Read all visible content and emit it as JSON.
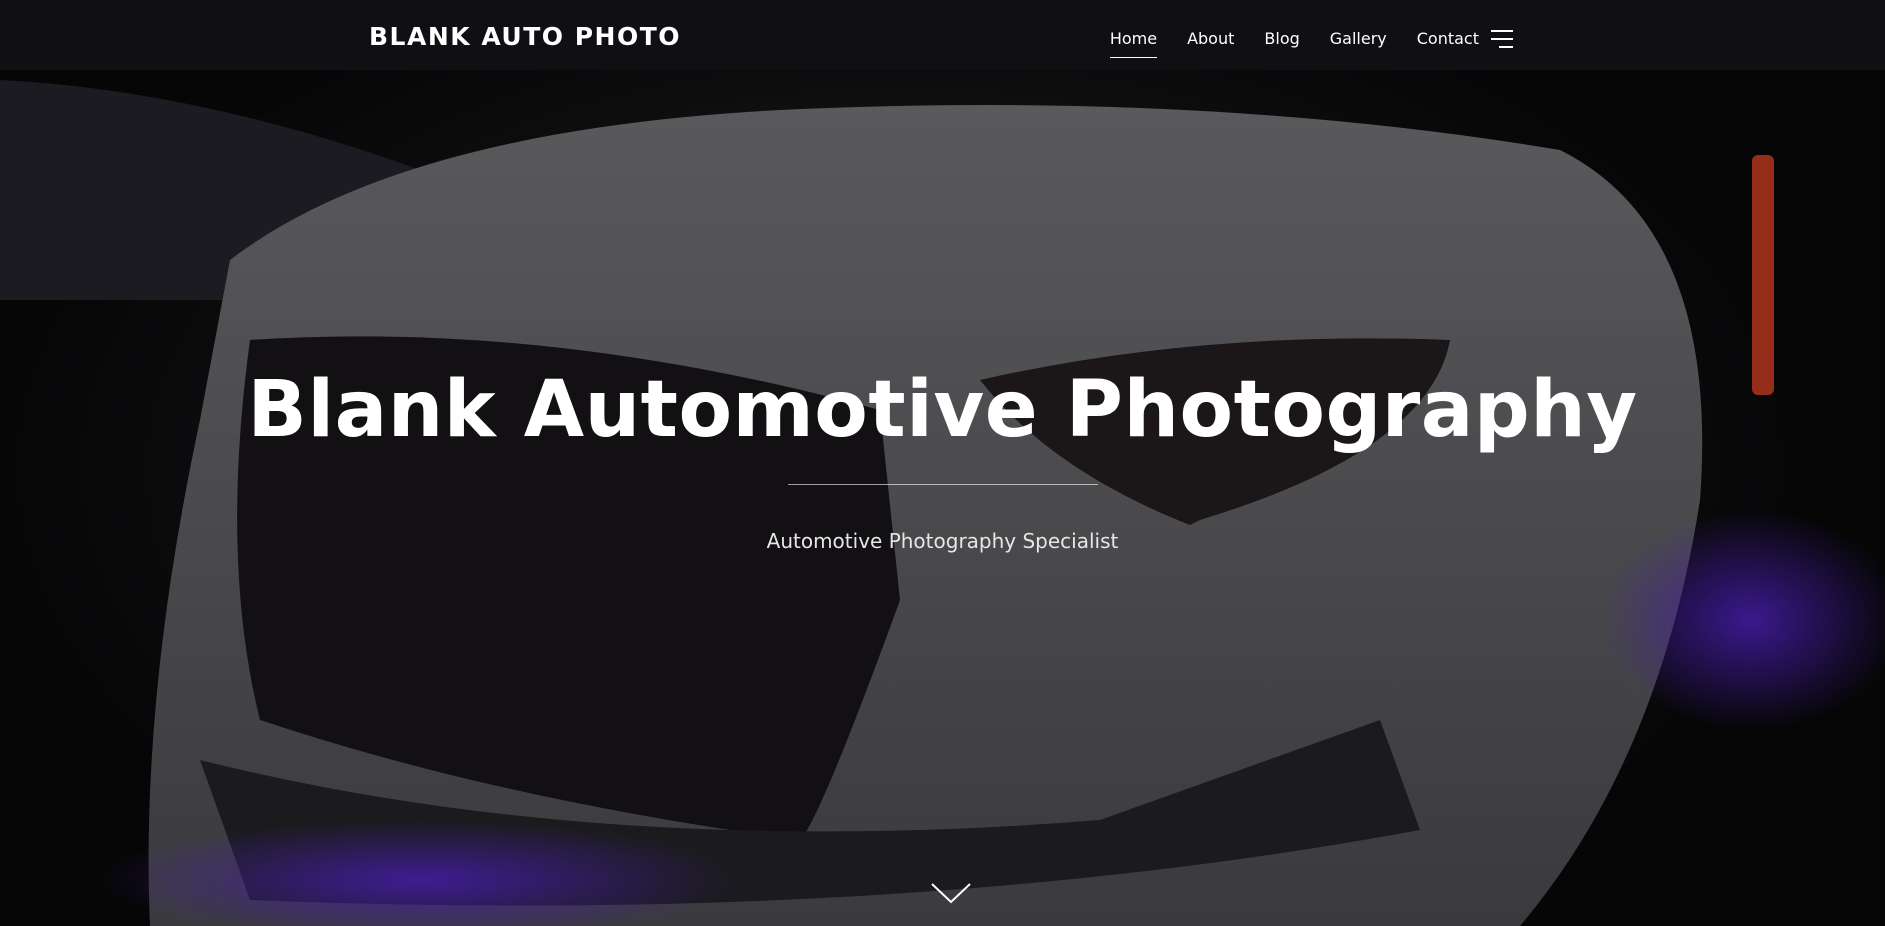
{
  "header": {
    "site_title": "BLANK AUTO PHOTO",
    "nav": [
      {
        "label": "Home",
        "active": true
      },
      {
        "label": "About",
        "active": false
      },
      {
        "label": "Blog",
        "active": false
      },
      {
        "label": "Gallery",
        "active": false
      },
      {
        "label": "Contact",
        "active": false
      }
    ],
    "menu_icon": "hamburger-menu-icon"
  },
  "hero": {
    "title": "Blank Automotive Photography",
    "subtitle": "Automotive Photography Specialist",
    "background": "dark night photo of a white sports car front with purple underglow",
    "scroll_icon": "chevron-down-icon"
  },
  "colors": {
    "text": "#ffffff",
    "accent_underglow": "#6a2cff"
  }
}
